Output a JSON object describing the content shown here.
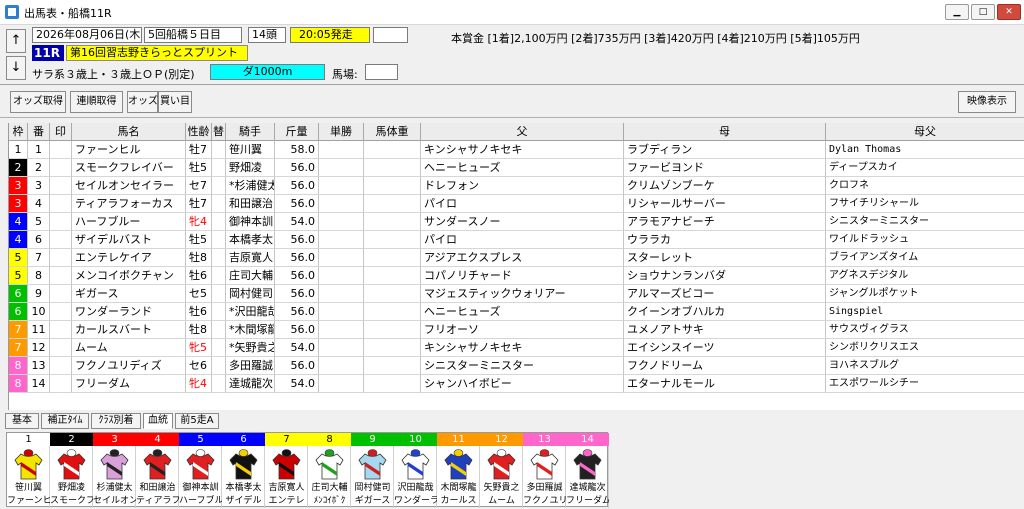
{
  "window": {
    "title": "出馬表・船橋11R"
  },
  "header": {
    "date": "2026年08月06日(木)",
    "meeting": "5回船橋５日目",
    "runners": "14頭",
    "post_time": "20:05発走",
    "race_number": "11R",
    "race_name": "第16回習志野きらっとスプリント",
    "conditions": "サラ系３歳上・３歳上ＯＰ(別定)",
    "course": "ダ1000m",
    "track_label": "馬場:",
    "prize": "本賞金 [1着]2,100万円 [2着]735万円 [3着]420万円 [4着]210万円 [5着]105万円"
  },
  "toolbar": {
    "odds": "オッズ取得",
    "exacta": "連順取得",
    "odds2": "オッズ",
    "betting": "買い目",
    "video": "映像表示"
  },
  "columns": [
    "枠",
    "番",
    "印",
    "馬名",
    "性齢",
    "替",
    "騎手",
    "斤量",
    "単勝",
    "馬体重",
    "父",
    "母",
    "母父"
  ],
  "colors": {
    "waku": [
      "#ffffff",
      "#000000",
      "#ff0000",
      "#0000ff",
      "#ffff00",
      "#00c000",
      "#ff9900",
      "#ff66cc"
    ],
    "waku_text": [
      "#000000",
      "#ffffff",
      "#ffffff",
      "#ffffff",
      "#000000",
      "#ffffff",
      "#ffffff",
      "#ffffff"
    ],
    "mare": "#ff0000"
  },
  "rows": [
    {
      "waku": "1",
      "num": "1",
      "name": "ファーンヒル",
      "sex": "牡7",
      "jockey": "笹川翼",
      "weight": "58.0",
      "sire": "キンシャサノキセキ",
      "dam": "ラブディラン",
      "damsire": "Dylan Thomas"
    },
    {
      "waku": "2",
      "num": "2",
      "name": "スモークフレイバー",
      "sex": "牡5",
      "jockey": "野畑凌",
      "weight": "56.0",
      "sire": "ヘニーヒューズ",
      "dam": "ファービヨンド",
      "damsire": "ディープスカイ"
    },
    {
      "waku": "3",
      "num": "3",
      "name": "セイルオンセイラー",
      "sex": "セ7",
      "jockey": "*杉浦健太",
      "weight": "56.0",
      "sire": "ドレフォン",
      "dam": "クリムゾンブーケ",
      "damsire": "クロフネ"
    },
    {
      "waku": "3",
      "num": "4",
      "name": "ティアラフォーカス",
      "sex": "牡7",
      "jockey": "和田譲治",
      "weight": "56.0",
      "sire": "パイロ",
      "dam": "リシャールサーバー",
      "damsire": "フサイチリシャール"
    },
    {
      "waku": "4",
      "num": "5",
      "name": "ハーフブルー",
      "sex": "牝4",
      "jockey": "御神本訓",
      "weight": "54.0",
      "sire": "サンダースノー",
      "dam": "アラモアナビーチ",
      "damsire": "シニスターミニスター"
    },
    {
      "waku": "4",
      "num": "6",
      "name": "ザイデルバスト",
      "sex": "牡5",
      "jockey": "本橋孝太",
      "weight": "56.0",
      "sire": "パイロ",
      "dam": "ウララカ",
      "damsire": "ワイルドラッシュ"
    },
    {
      "waku": "5",
      "num": "7",
      "name": "エンテレケイア",
      "sex": "牡8",
      "jockey": "吉原寛人",
      "weight": "56.0",
      "sire": "アジアエクスプレス",
      "dam": "スターレット",
      "damsire": "ブライアンズタイム"
    },
    {
      "waku": "5",
      "num": "8",
      "name": "メンコイボクチャン",
      "sex": "牡6",
      "jockey": "庄司大輔",
      "weight": "56.0",
      "sire": "コパノリチャード",
      "dam": "ショウナンランバダ",
      "damsire": "アグネスデジタル"
    },
    {
      "waku": "6",
      "num": "9",
      "name": "ギガース",
      "sex": "セ5",
      "jockey": "岡村健司",
      "weight": "56.0",
      "sire": "マジェスティックウォリアー",
      "dam": "アルマーズビコー",
      "damsire": "ジャングルポケット"
    },
    {
      "waku": "6",
      "num": "10",
      "name": "ワンダーランド",
      "sex": "牡6",
      "jockey": "*沢田龍哉",
      "weight": "56.0",
      "sire": "ヘニーヒューズ",
      "dam": "クイーンオブハルカ",
      "damsire": "Singspiel"
    },
    {
      "waku": "7",
      "num": "11",
      "name": "カールスバート",
      "sex": "牡8",
      "jockey": "*木間塚龍",
      "weight": "56.0",
      "sire": "フリオーソ",
      "dam": "ユメノアトサキ",
      "damsire": "サウスヴィグラス"
    },
    {
      "waku": "7",
      "num": "12",
      "name": "ムーム",
      "sex": "牝5",
      "jockey": "*矢野貴之",
      "weight": "54.0",
      "sire": "キンシャサノキセキ",
      "dam": "エイシンスイーツ",
      "damsire": "シンボリクリスエス"
    },
    {
      "waku": "8",
      "num": "13",
      "name": "フクノユリディズ",
      "sex": "セ6",
      "jockey": "多田羅誠",
      "weight": "56.0",
      "sire": "シニスターミニスター",
      "dam": "フクノドリーム",
      "damsire": "ヨハネスブルグ"
    },
    {
      "waku": "8",
      "num": "14",
      "name": "フリーダム",
      "sex": "牝4",
      "jockey": "達城龍次",
      "weight": "54.0",
      "sire": "シャンハイボビー",
      "dam": "エターナルモール",
      "damsire": "エスポワールシチー"
    }
  ],
  "tabs": [
    "基本",
    "補正ﾀｲﾑ",
    "ｸﾗｽ別着",
    "血統",
    "前5走A"
  ],
  "silks": [
    {
      "num": "1",
      "jockey": "笹川翼",
      "horse": "ファーンヒ",
      "c1": "#f4e400",
      "c2": "#cc0000"
    },
    {
      "num": "2",
      "jockey": "野畑凌",
      "horse": "スモークフ",
      "c1": "#e01010",
      "c2": "#ffffff"
    },
    {
      "num": "3",
      "jockey": "杉浦健太",
      "horse": "セイルオン",
      "c1": "#d9a0d9",
      "c2": "#222222"
    },
    {
      "num": "4",
      "jockey": "和田譲治",
      "horse": "ティアラフ",
      "c1": "#e02020",
      "c2": "#222222"
    },
    {
      "num": "5",
      "jockey": "御神本訓",
      "horse": "ハーフブル",
      "c1": "#e02020",
      "c2": "#ffffff"
    },
    {
      "num": "6",
      "jockey": "本橋孝太",
      "horse": "ザイデル",
      "c1": "#111111",
      "c2": "#f4d000"
    },
    {
      "num": "7",
      "jockey": "吉原寛人",
      "horse": "エンテレ",
      "c1": "#cc0000",
      "c2": "#111111"
    },
    {
      "num": "8",
      "jockey": "庄司大輔",
      "horse": "ﾒﾝｺｲﾎﾞｸ",
      "c1": "#ffffff",
      "c2": "#20a020"
    },
    {
      "num": "9",
      "jockey": "岡村健司",
      "horse": "ギガース",
      "c1": "#a8d8f0",
      "c2": "#cc2020"
    },
    {
      "num": "10",
      "jockey": "沢田龍哉",
      "horse": "ワンダーラ",
      "c1": "#ffffff",
      "c2": "#2040d0"
    },
    {
      "num": "11",
      "jockey": "木間塚龍",
      "horse": "カールス",
      "c1": "#2040c0",
      "c2": "#f4d000"
    },
    {
      "num": "12",
      "jockey": "矢野貴之",
      "horse": "ムーム",
      "c1": "#e02020",
      "c2": "#ffffff"
    },
    {
      "num": "13",
      "jockey": "多田羅誠",
      "horse": "フクノユリ",
      "c1": "#ffffff",
      "c2": "#e02020"
    },
    {
      "num": "14",
      "jockey": "達城龍次",
      "horse": "フリーダム",
      "c1": "#222222",
      "c2": "#ff66cc"
    }
  ]
}
